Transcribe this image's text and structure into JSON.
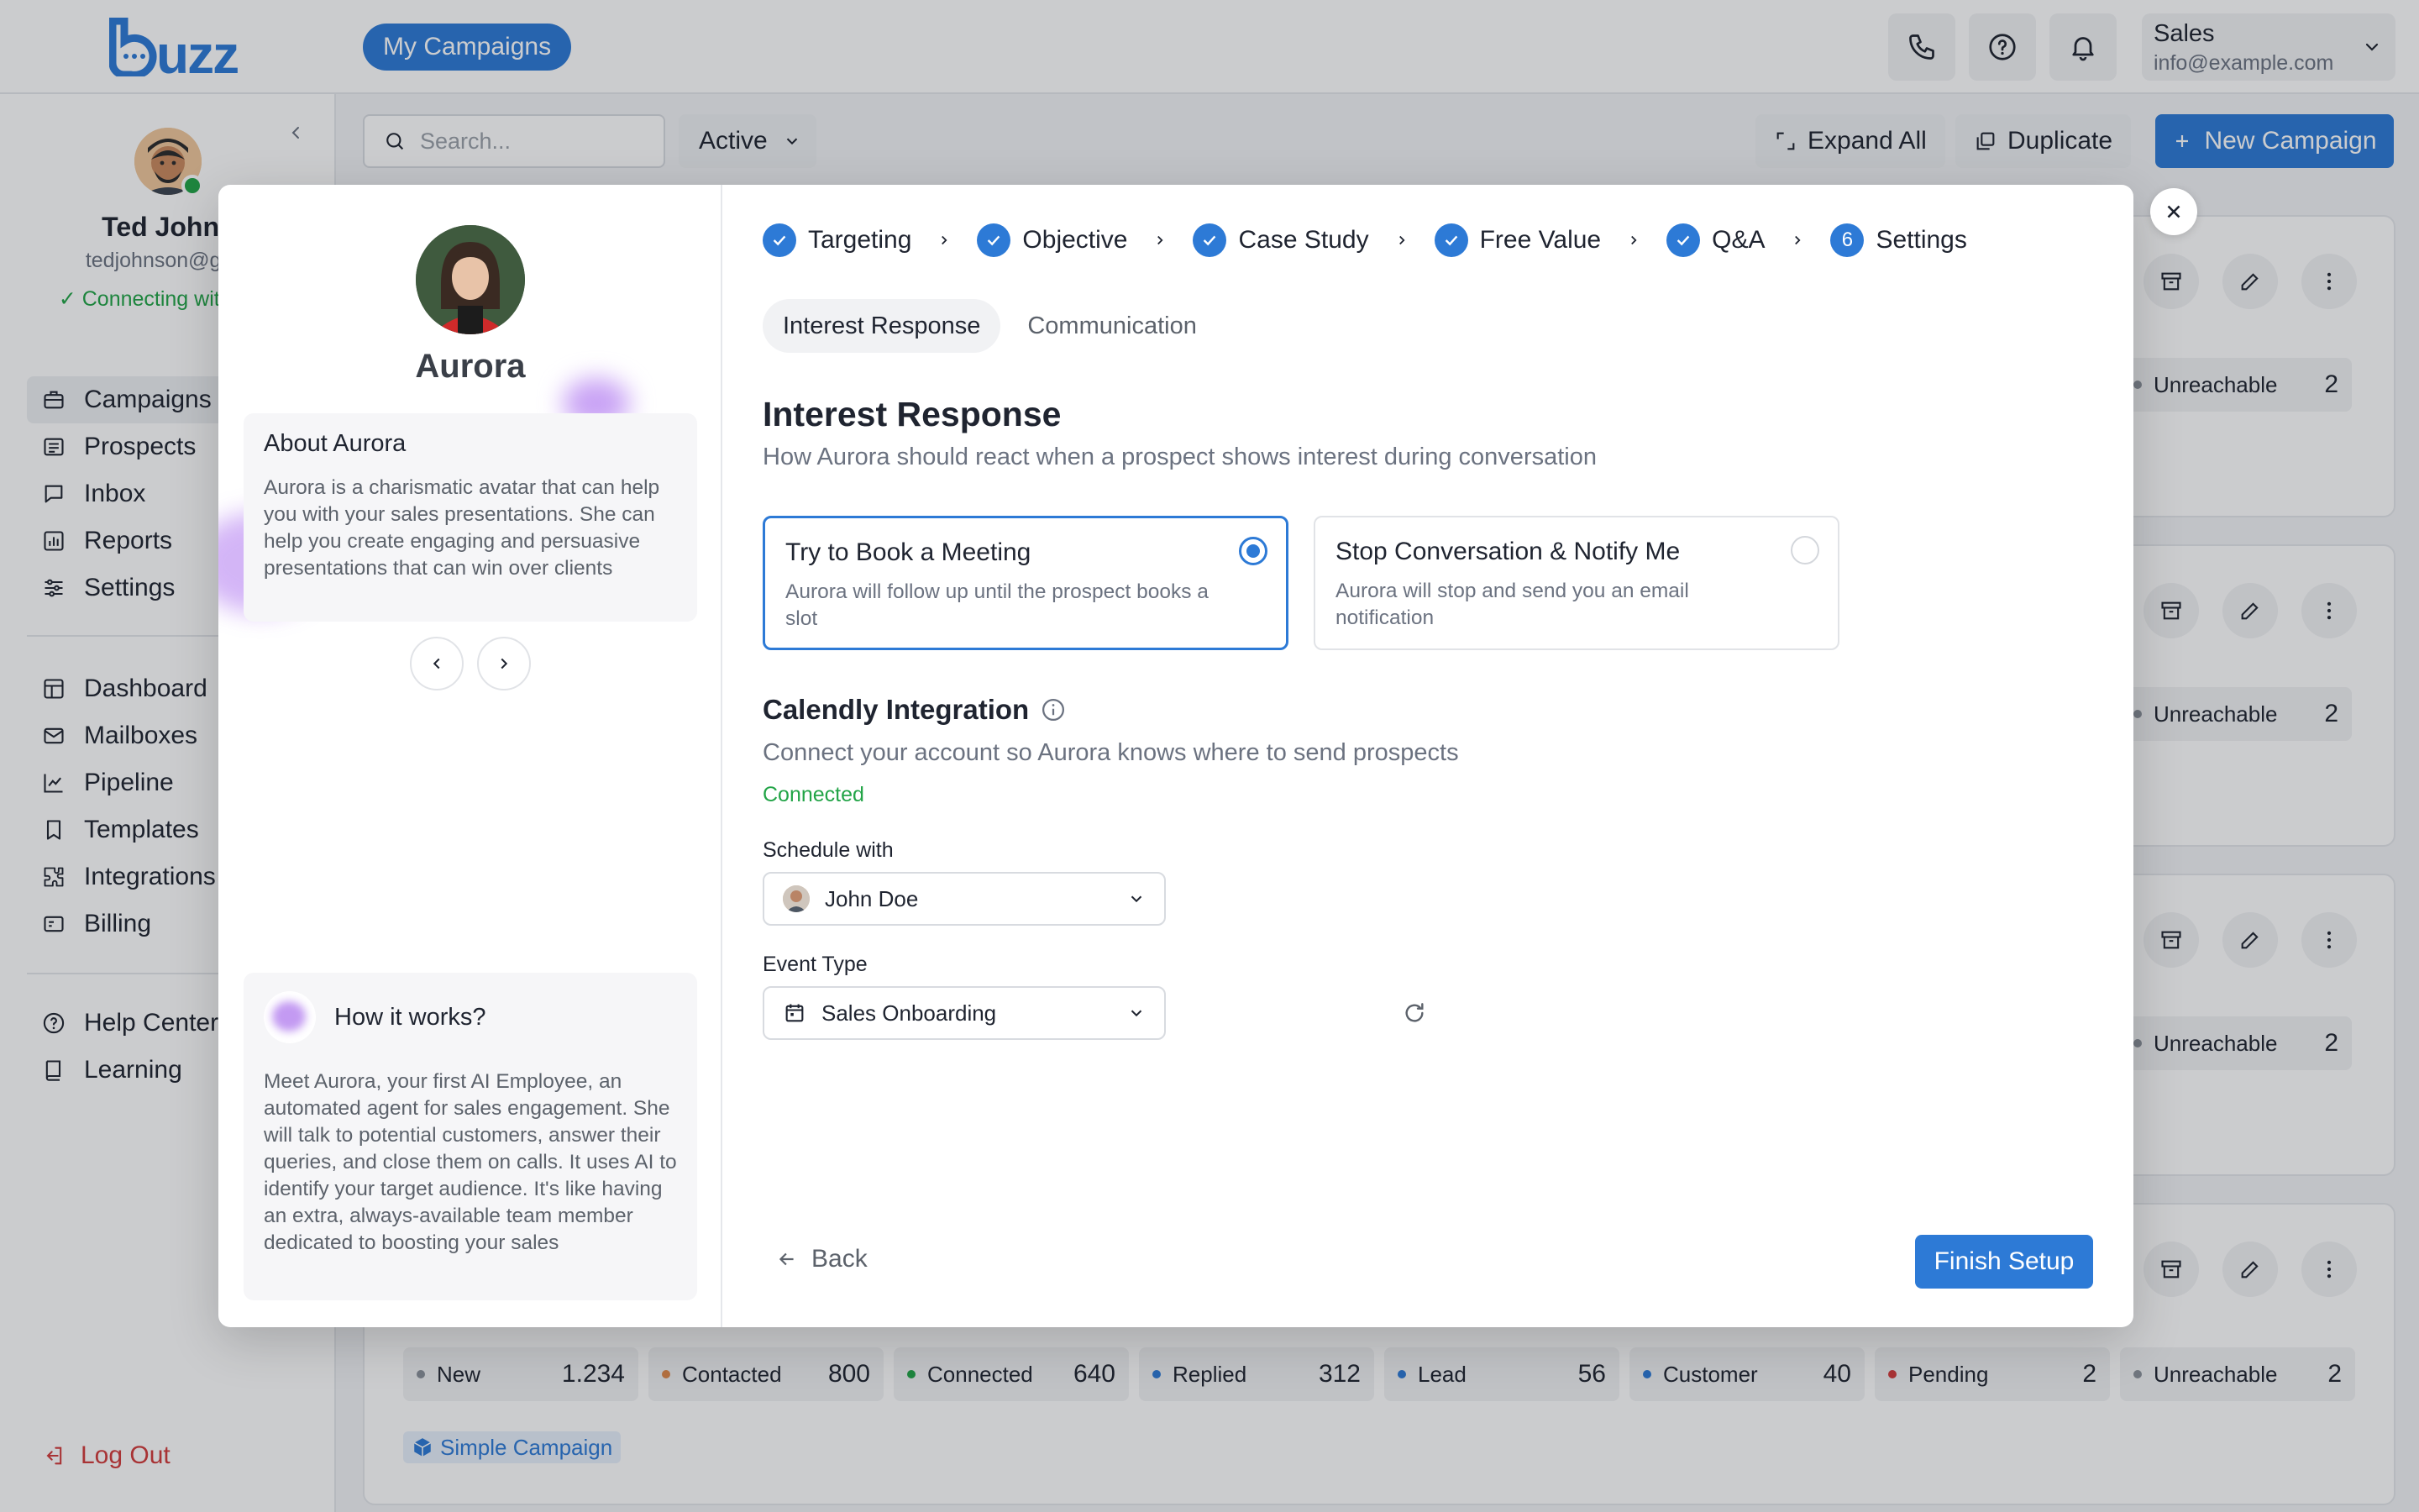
{
  "header": {
    "logo": "buzz",
    "my_campaigns": "My Campaigns",
    "account_name": "Sales",
    "account_email": "info@example.com"
  },
  "sidebar": {
    "user_name": "Ted Johns",
    "user_email": "tedjohnson@gma",
    "status": "Connecting with Venti",
    "nav_main": [
      {
        "label": "Campaigns",
        "icon": "briefcase-icon"
      },
      {
        "label": "Prospects",
        "icon": "list-icon"
      },
      {
        "label": "Inbox",
        "icon": "chat-icon"
      },
      {
        "label": "Reports",
        "icon": "bar-chart-icon"
      },
      {
        "label": "Settings",
        "icon": "sliders-icon"
      }
    ],
    "nav_secondary": [
      {
        "label": "Dashboard",
        "icon": "dashboard-icon"
      },
      {
        "label": "Mailboxes",
        "icon": "mail-icon"
      },
      {
        "label": "Pipeline",
        "icon": "line-chart-icon"
      },
      {
        "label": "Templates",
        "icon": "bookmark-icon"
      },
      {
        "label": "Integrations",
        "icon": "puzzle-icon"
      },
      {
        "label": "Billing",
        "icon": "billing-icon"
      }
    ],
    "nav_help": [
      {
        "label": "Help Center",
        "icon": "help-icon"
      },
      {
        "label": "Learning",
        "icon": "book-icon"
      }
    ],
    "logout": "Log Out"
  },
  "toolbar": {
    "search_placeholder": "Search...",
    "filter": "Active",
    "expand_all": "Expand All",
    "duplicate": "Duplicate",
    "new_campaign": "New Campaign"
  },
  "cards": {
    "unreachable_label": "Unreachable",
    "unreachable_value": "2",
    "stats": [
      {
        "label": "New",
        "value": "1.234",
        "color": "#8b919a"
      },
      {
        "label": "Contacted",
        "value": "800",
        "color": "#e0894a"
      },
      {
        "label": "Connected",
        "value": "640",
        "color": "#22a447"
      },
      {
        "label": "Replied",
        "value": "312",
        "color": "#2d7ad6"
      },
      {
        "label": "Lead",
        "value": "56",
        "color": "#2d7ad6"
      },
      {
        "label": "Customer",
        "value": "40",
        "color": "#2d7ad6"
      },
      {
        "label": "Pending",
        "value": "2",
        "color": "#d23b3b"
      },
      {
        "label": "Unreachable",
        "value": "2",
        "color": "#8b919a"
      }
    ],
    "campaign_tag": "Simple Campaign"
  },
  "modal": {
    "agent_name": "Aurora",
    "about_title": "About Aurora",
    "about_text": "Aurora is a charismatic avatar that can help you with your sales presentations. She can help you create engaging and persuasive presentations that can win over clients",
    "how_title": "How it works?",
    "how_text": "Meet Aurora, your first AI Employee, an automated agent for sales engagement. She will talk to potential customers, answer their queries, and close them on calls. It uses AI to identify your target audience. It's like having an extra, always-available team member dedicated to boosting your sales",
    "steps": [
      {
        "label": "Targeting",
        "mark": "check"
      },
      {
        "label": "Objective",
        "mark": "check"
      },
      {
        "label": "Case Study",
        "mark": "check"
      },
      {
        "label": "Free Value",
        "mark": "check"
      },
      {
        "label": "Q&A",
        "mark": "check"
      },
      {
        "label": "Settings",
        "mark": "6"
      }
    ],
    "tabs": [
      "Interest Response",
      "Communication"
    ],
    "section_title": "Interest Response",
    "section_subtitle": "How Aurora should react when a prospect shows interest during conversation",
    "options": [
      {
        "title": "Try to Book a Meeting",
        "desc": "Aurora will follow up until the prospect books a slot",
        "selected": true
      },
      {
        "title": "Stop Conversation & Notify Me",
        "desc": "Aurora will stop and send you an email notification",
        "selected": false
      }
    ],
    "calendly_title": "Calendly Integration",
    "calendly_subtitle": "Connect your account so Aurora knows where to send prospects",
    "calendly_status": "Connected",
    "schedule_label": "Schedule with",
    "schedule_value": "John Doe",
    "event_label": "Event Type",
    "event_value": "Sales Onboarding",
    "back": "Back",
    "finish": "Finish Setup"
  }
}
